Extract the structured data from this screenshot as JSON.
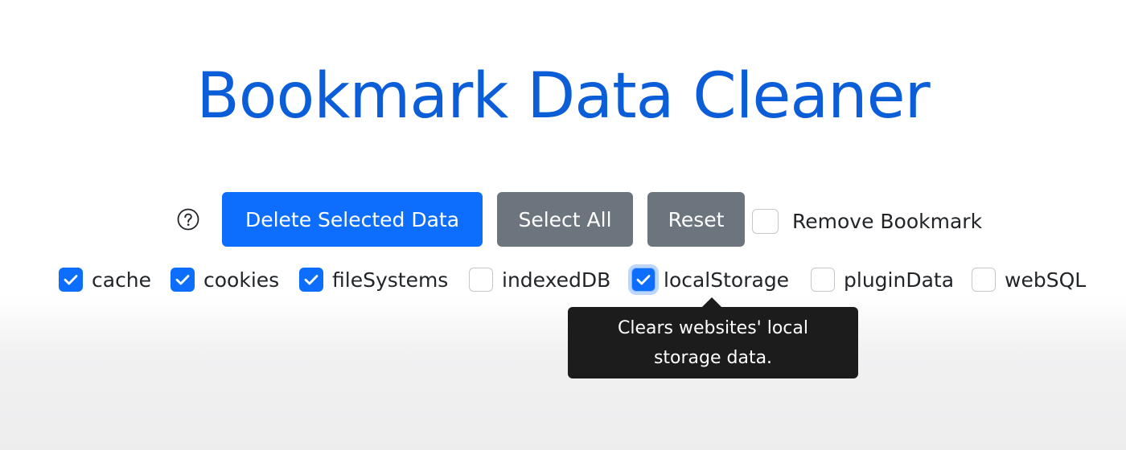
{
  "app": {
    "title": "Bookmark Data Cleaner"
  },
  "toolbar": {
    "help_icon": "question-circle-icon",
    "delete_label": "Delete Selected Data",
    "select_all_label": "Select All",
    "reset_label": "Reset",
    "remove_bookmark_label": "Remove Bookmark",
    "remove_bookmark_checked": false
  },
  "data_types": [
    {
      "label": "cache",
      "checked": true
    },
    {
      "label": "cookies",
      "checked": true
    },
    {
      "label": "fileSystems",
      "checked": true
    },
    {
      "label": "indexedDB",
      "checked": false
    },
    {
      "label": "localStorage",
      "checked": true,
      "focused": true
    },
    {
      "label": "pluginData",
      "checked": false
    },
    {
      "label": "webSQL",
      "checked": false
    }
  ],
  "tooltip": {
    "line1": "Clears websites' local",
    "line2": "storage data."
  },
  "colors": {
    "primary": "#0d6efd",
    "secondary": "#6c757d",
    "title": "#0b5ed7",
    "tooltip_bg": "#1c1c1c"
  }
}
